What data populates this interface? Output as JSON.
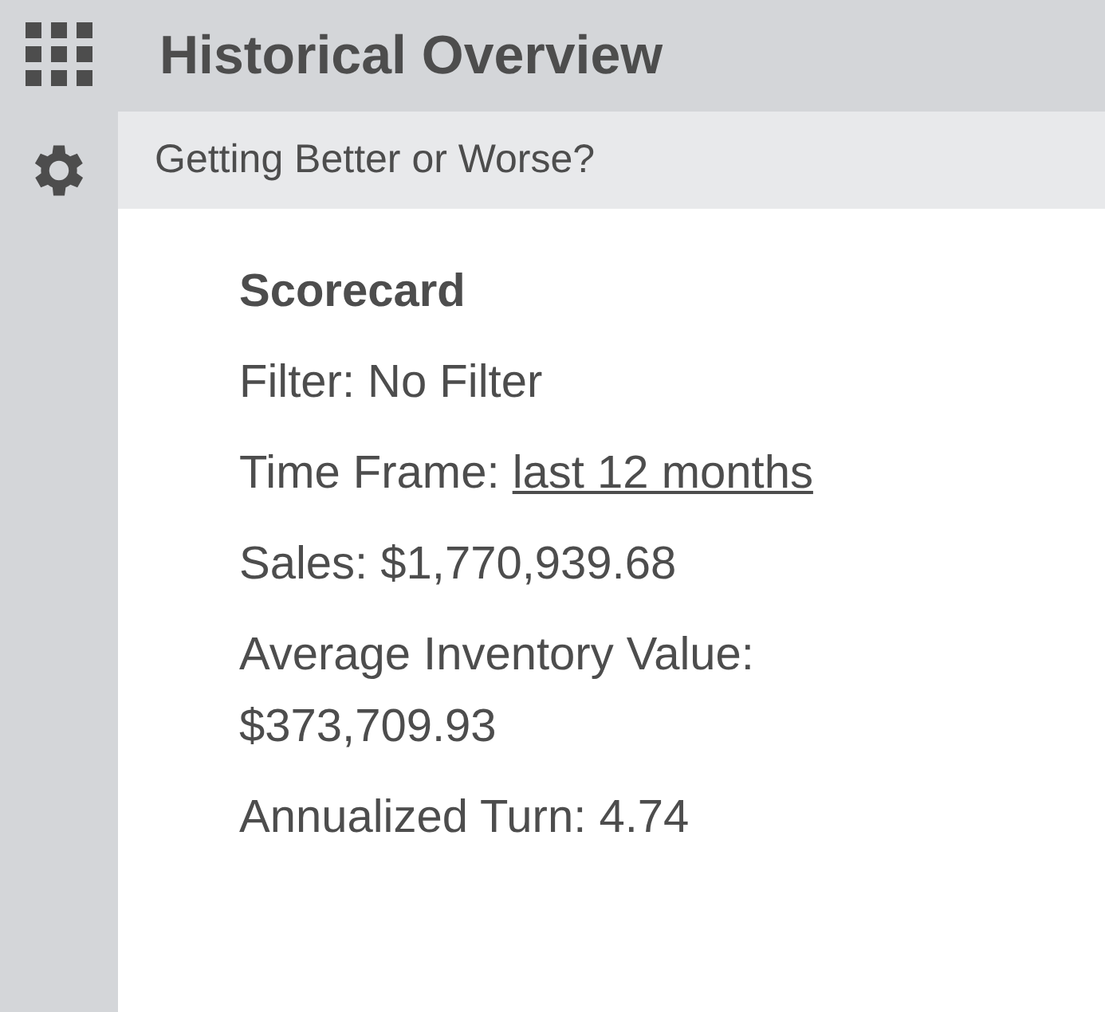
{
  "header": {
    "title": "Historical Overview"
  },
  "subheader": {
    "title": "Getting Better or Worse?"
  },
  "scorecard": {
    "heading": "Scorecard",
    "items": [
      {
        "kind": "text",
        "text": "Filter: No Filter"
      },
      {
        "kind": "link",
        "label": "Time Frame:",
        "link": "last 12 months"
      },
      {
        "kind": "text",
        "text": "Sales: $1,770,939.68"
      },
      {
        "kind": "text",
        "text": "Average Inventory Value: $373,709.93"
      },
      {
        "kind": "text",
        "text": "Annualized Turn: 4.74"
      }
    ]
  }
}
